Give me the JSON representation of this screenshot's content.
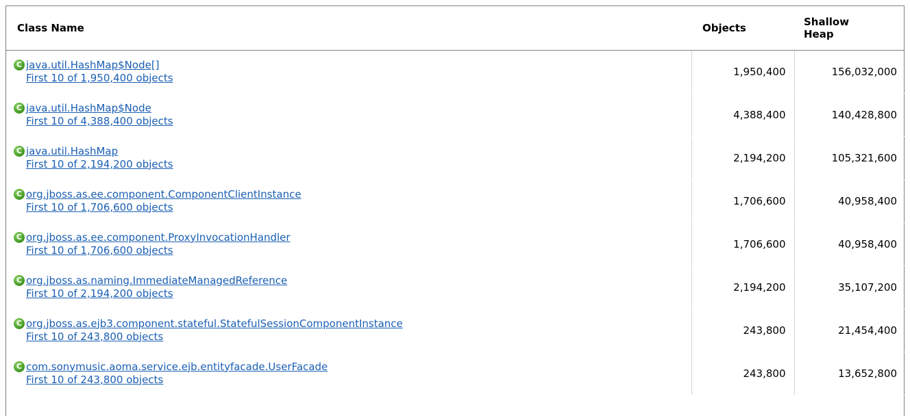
{
  "table": {
    "headers": {
      "class_name": "Class Name",
      "objects": "Objects",
      "shallow_heap": "Shallow Heap"
    },
    "rows": [
      {
        "icon": "class-icon",
        "class_name": "java.util.HashMap$Node[]",
        "sub_link": "First 10 of 1,950,400 objects",
        "objects": "1,950,400",
        "shallow_heap": "156,032,000"
      },
      {
        "icon": "class-icon",
        "class_name": "java.util.HashMap$Node",
        "sub_link": "First 10 of 4,388,400 objects",
        "objects": "4,388,400",
        "shallow_heap": "140,428,800"
      },
      {
        "icon": "class-icon",
        "class_name": "java.util.HashMap",
        "sub_link": "First 10 of 2,194,200 objects",
        "objects": "2,194,200",
        "shallow_heap": "105,321,600"
      },
      {
        "icon": "class-icon",
        "class_name": "org.jboss.as.ee.component.ComponentClientInstance",
        "sub_link": "First 10 of 1,706,600 objects",
        "objects": "1,706,600",
        "shallow_heap": "40,958,400"
      },
      {
        "icon": "class-icon",
        "class_name": "org.jboss.as.ee.component.ProxyInvocationHandler",
        "sub_link": "First 10 of 1,706,600 objects",
        "objects": "1,706,600",
        "shallow_heap": "40,958,400"
      },
      {
        "icon": "class-icon",
        "class_name": "org.jboss.as.naming.ImmediateManagedReference",
        "sub_link": "First 10 of 2,194,200 objects",
        "objects": "2,194,200",
        "shallow_heap": "35,107,200"
      },
      {
        "icon": "class-icon",
        "class_name": "org.jboss.as.ejb3.component.stateful.StatefulSessionComponentInstance",
        "sub_link": "First 10 of 243,800 objects",
        "objects": "243,800",
        "shallow_heap": "21,454,400"
      },
      {
        "icon": "class-icon",
        "class_name": "com.sonymusic.aoma.service.ejb.entityfacade.UserFacade",
        "sub_link": "First 10 of 243,800 objects",
        "objects": "243,800",
        "shallow_heap": "13,652,800"
      }
    ],
    "icon_glyph": "C",
    "colors": {
      "link": "#1a5fb4",
      "icon_green": "#4ea52c",
      "border": "#7f7f7f"
    }
  }
}
